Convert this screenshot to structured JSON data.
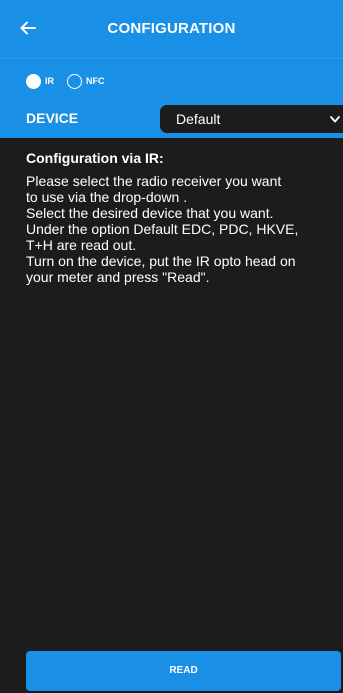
{
  "header": {
    "title": "CONFIGURATION",
    "back_icon": "arrow-left-icon"
  },
  "mode": {
    "options": [
      {
        "label": "IR",
        "selected": true
      },
      {
        "label": "NFC",
        "selected": false
      }
    ]
  },
  "device": {
    "label": "DEVICE",
    "selected_value": "Default"
  },
  "content": {
    "title": "Configuration via IR:",
    "lines": [
      "Please select the radio receiver you want",
      "to use via the drop-down .",
      "Select the desired device that you want.",
      "Under the option Default EDC, PDC, HKVE,",
      "T+H are read out.",
      "Turn on the device, put the IR opto head on",
      "your meter and press \"Read\"."
    ]
  },
  "actions": {
    "read_label": "READ"
  },
  "colors": {
    "accent": "#1a8fe6",
    "background": "#1c1c1c",
    "text": "#ffffff"
  }
}
